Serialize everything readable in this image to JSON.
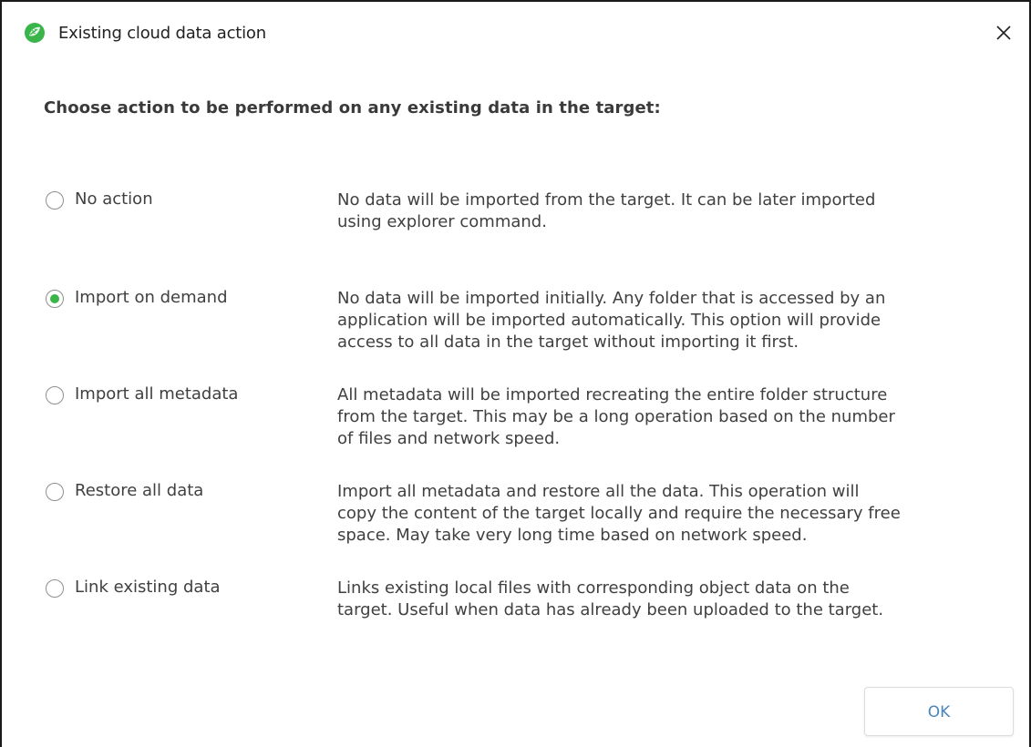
{
  "window": {
    "title": "Existing cloud data action",
    "app_icon": "leaf-logo-icon",
    "close_icon": "close-icon",
    "accent_color": "#39b54a"
  },
  "heading": "Choose action to be performed on any existing data in the target:",
  "options": [
    {
      "label": "No action",
      "checked": false,
      "description": [
        "No data will be imported from the target. It can be later imported",
        "using explorer command."
      ]
    },
    {
      "label": "Import on demand",
      "checked": true,
      "description": [
        "No data will be imported initially. Any folder that is accessed by an",
        "application will be imported automatically. This option will provide",
        "access to all data in the target without importing it first."
      ]
    },
    {
      "label": "Import all metadata",
      "checked": false,
      "description": [
        "All metadata will be imported recreating the entire folder structure",
        "from the target. This may be a long operation based on the number",
        "of files and network speed."
      ]
    },
    {
      "label": "Restore all data",
      "checked": false,
      "description": [
        "Import all metadata and restore all the data. This operation will",
        "copy the content of the target locally and require the necessary free",
        "space. May take very long time based on network speed."
      ]
    },
    {
      "label": "Link existing data",
      "checked": false,
      "description": [
        "Links existing local files with corresponding object data on the",
        "target. Useful when data has already been uploaded to the target."
      ]
    }
  ],
  "buttons": {
    "ok_label": "OK"
  }
}
